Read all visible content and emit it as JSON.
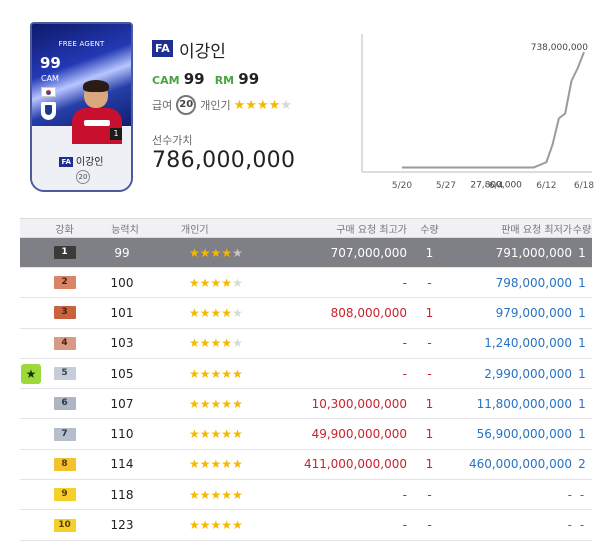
{
  "card": {
    "label": "FREE AGENT",
    "ovr": "99",
    "position": "CAM",
    "name": "이강인",
    "fa_tag": "FA",
    "upgrade_level": "1",
    "salary": "20"
  },
  "player": {
    "fa_tag": "FA",
    "name": "이강인",
    "positions": [
      {
        "code": "CAM",
        "ovr": "99"
      },
      {
        "code": "RM",
        "ovr": "99"
      }
    ],
    "salary_label": "급여",
    "salary": "20",
    "skill_label": "개인기",
    "skill_stars": 4,
    "value_label": "선수가치",
    "value": "786,000,000"
  },
  "chart_data": {
    "type": "line",
    "title": "",
    "x_ticks": [
      "5/20",
      "5/27",
      "6/4",
      "6/12",
      "6/18"
    ],
    "series": [
      {
        "points": [
          [
            "5/20",
            27800000
          ],
          [
            "5/27",
            27800000
          ],
          [
            "6/4",
            27800000
          ],
          [
            "6/10",
            27800000
          ],
          [
            "6/12",
            60000000
          ],
          [
            "6/13",
            170000000
          ],
          [
            "6/14",
            330000000
          ],
          [
            "6/15",
            360000000
          ],
          [
            "6/16",
            560000000
          ],
          [
            "6/17",
            640000000
          ],
          [
            "6/18",
            738000000
          ]
        ]
      }
    ],
    "annotations": [
      {
        "label": "738,000,000",
        "x": "6/18",
        "y": 738000000
      },
      {
        "label": "27,800,000",
        "x": "6/4",
        "y": 27800000
      }
    ],
    "ylim": [
      0,
      800000000
    ],
    "grid": false
  },
  "table": {
    "headers": {
      "upgrade": "강화",
      "ovr": "능력치",
      "skill": "개인기",
      "buy_price": "구매 요청 최고가",
      "buy_qty": "수량",
      "sell_price": "판매 요청 최저가",
      "sell_qty": "수량"
    },
    "rows": [
      {
        "level": "1",
        "ovr": "99",
        "stars": 4,
        "buy_price": "707,000,000",
        "buy_qty": "1",
        "sell_price": "791,000,000",
        "sell_qty": "1",
        "badge_bg": "#3a3a3a",
        "badge_fg": "#ffffff",
        "current": true
      },
      {
        "level": "2",
        "ovr": "100",
        "stars": 4,
        "buy_price": "-",
        "buy_qty": "-",
        "sell_price": "798,000,000",
        "sell_qty": "1",
        "badge_bg": "#d98466",
        "badge_fg": "#4a1f10"
      },
      {
        "level": "3",
        "ovr": "101",
        "stars": 4,
        "buy_price": "808,000,000",
        "buy_qty": "1",
        "sell_price": "979,000,000",
        "sell_qty": "1",
        "badge_bg": "#c9623f",
        "badge_fg": "#4a1f10"
      },
      {
        "level": "4",
        "ovr": "103",
        "stars": 4,
        "buy_price": "-",
        "buy_qty": "-",
        "sell_price": "1,240,000,000",
        "sell_qty": "1",
        "badge_bg": "#d99a85",
        "badge_fg": "#4a1f10"
      },
      {
        "level": "5",
        "ovr": "105",
        "stars": 5,
        "buy_price": "-",
        "buy_qty": "-",
        "sell_price": "2,990,000,000",
        "sell_qty": "1",
        "badge_bg": "#c7cdd8",
        "badge_fg": "#3a4250",
        "favorite": true
      },
      {
        "level": "6",
        "ovr": "107",
        "stars": 5,
        "buy_price": "10,300,000,000",
        "buy_qty": "1",
        "sell_price": "11,800,000,000",
        "sell_qty": "1",
        "badge_bg": "#aeb6c4",
        "badge_fg": "#2e3644"
      },
      {
        "level": "7",
        "ovr": "110",
        "stars": 5,
        "buy_price": "49,900,000,000",
        "buy_qty": "1",
        "sell_price": "56,900,000,000",
        "sell_qty": "1",
        "badge_bg": "#b6bdcb",
        "badge_fg": "#2e3644"
      },
      {
        "level": "8",
        "ovr": "114",
        "stars": 5,
        "buy_price": "411,000,000,000",
        "buy_qty": "1",
        "sell_price": "460,000,000,000",
        "sell_qty": "2",
        "badge_bg": "#f2c230",
        "badge_fg": "#5a3e00"
      },
      {
        "level": "9",
        "ovr": "118",
        "stars": 5,
        "buy_price": "-",
        "buy_qty": "-",
        "sell_price": "-",
        "sell_qty": "-",
        "badge_bg": "#f5cf2a",
        "badge_fg": "#5a3e00"
      },
      {
        "level": "10",
        "ovr": "123",
        "stars": 5,
        "buy_price": "-",
        "buy_qty": "-",
        "sell_price": "-",
        "sell_qty": "-",
        "badge_bg": "#f5cf2a",
        "badge_fg": "#5a3e00"
      }
    ]
  },
  "colors": {
    "brand": "#1d2f8f",
    "position": "#49a340",
    "buy": "#c9232e",
    "sell": "#2873c4",
    "star_on": "#f5b800",
    "star_off": "#d8d8d8",
    "favorite": "#9cd93b"
  },
  "icons": {
    "favorite": "star-icon",
    "flag": "korea-flag-icon",
    "club": "club-crest-icon"
  }
}
